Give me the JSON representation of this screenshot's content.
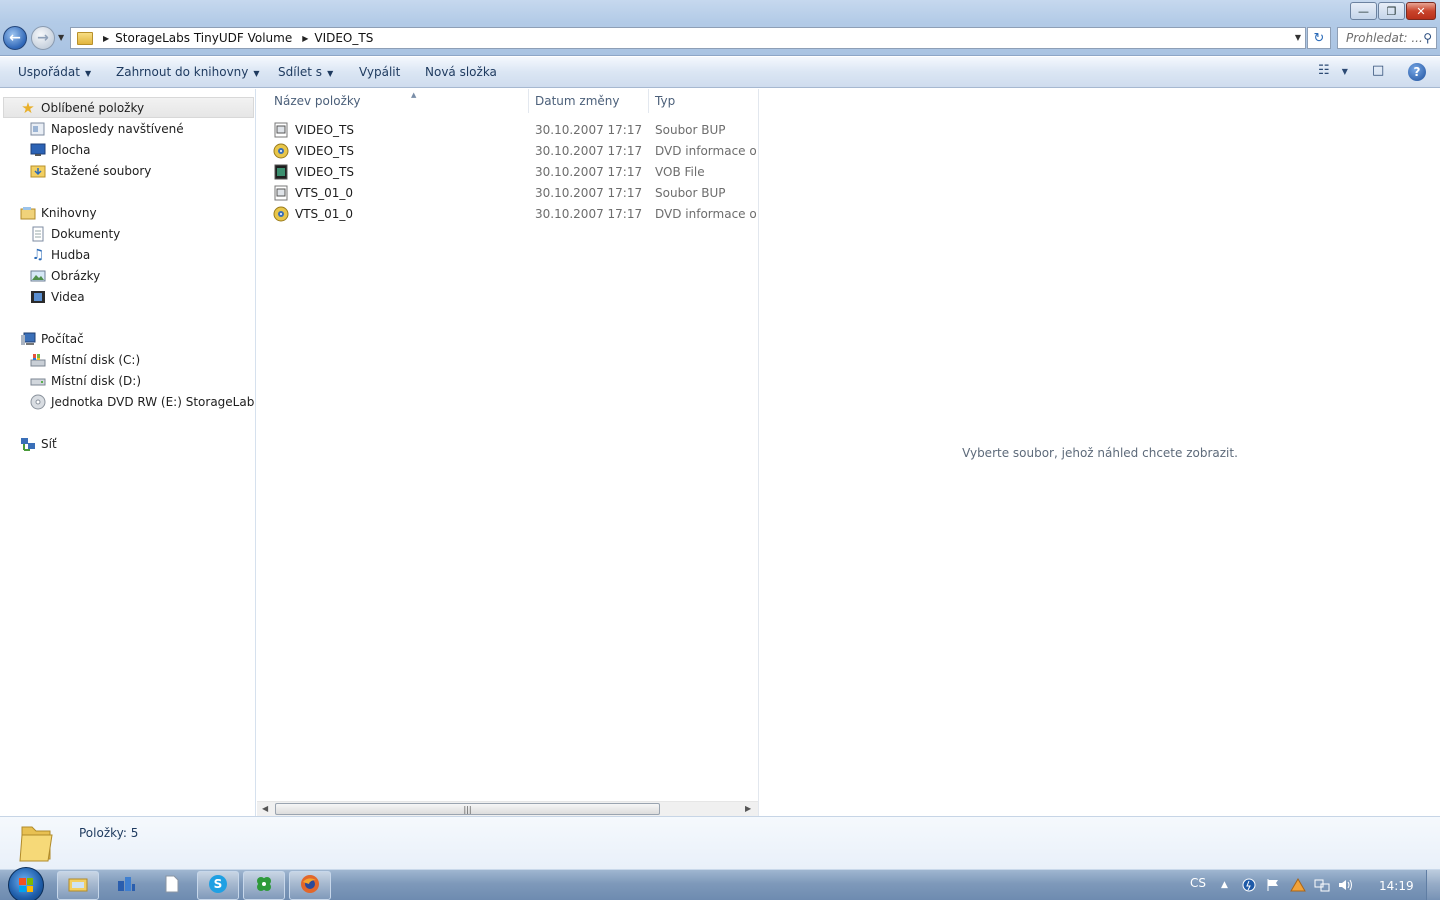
{
  "window": {
    "minimize_glyph": "—",
    "maximize_glyph": "❐",
    "close_glyph": "✕"
  },
  "address": {
    "crumbs": [
      "StorageLabs TinyUDF Volume",
      "VIDEO_TS"
    ],
    "search_placeholder": "Prohledat: ..."
  },
  "toolbar": {
    "organize": "Uspořádat",
    "include_library": "Zahrnout do knihovny",
    "share_with": "Sdílet s",
    "burn": "Vypálit",
    "new_folder": "Nová složka"
  },
  "nav": {
    "favorites": "Oblíbené položky",
    "recent": "Naposledy navštívené",
    "desktop": "Plocha",
    "downloads": "Stažené soubory",
    "libraries": "Knihovny",
    "documents": "Dokumenty",
    "music": "Hudba",
    "pictures": "Obrázky",
    "videos": "Videa",
    "computer": "Počítač",
    "drive_c": "Místní disk (C:)",
    "drive_d": "Místní disk (D:)",
    "drive_e": "Jednotka DVD RW (E:) StorageLabs TinyUDF Volume",
    "network": "Síť"
  },
  "columns": {
    "name": "Název položky",
    "date": "Datum změny",
    "type": "Typ"
  },
  "files": [
    {
      "name": "VIDEO_TS",
      "date": "30.10.2007 17:17",
      "type": "Soubor BUP",
      "icon": "bup-file-icon"
    },
    {
      "name": "VIDEO_TS",
      "date": "30.10.2007 17:17",
      "type": "DVD informace o f...",
      "icon": "ifo-file-icon"
    },
    {
      "name": "VIDEO_TS",
      "date": "30.10.2007 17:17",
      "type": "VOB File",
      "icon": "vob-file-icon"
    },
    {
      "name": "VTS_01_0",
      "date": "30.10.2007 17:17",
      "type": "Soubor BUP",
      "icon": "bup-file-icon"
    },
    {
      "name": "VTS_01_0",
      "date": "30.10.2007 17:17",
      "type": "DVD informace o f...",
      "icon": "ifo-file-icon"
    }
  ],
  "preview": {
    "message": "Vyberte soubor, jehož náhled chcete zobrazit."
  },
  "details": {
    "item_count": "Položky: 5"
  },
  "taskbar": {
    "language": "CS",
    "clock": "14:19"
  }
}
